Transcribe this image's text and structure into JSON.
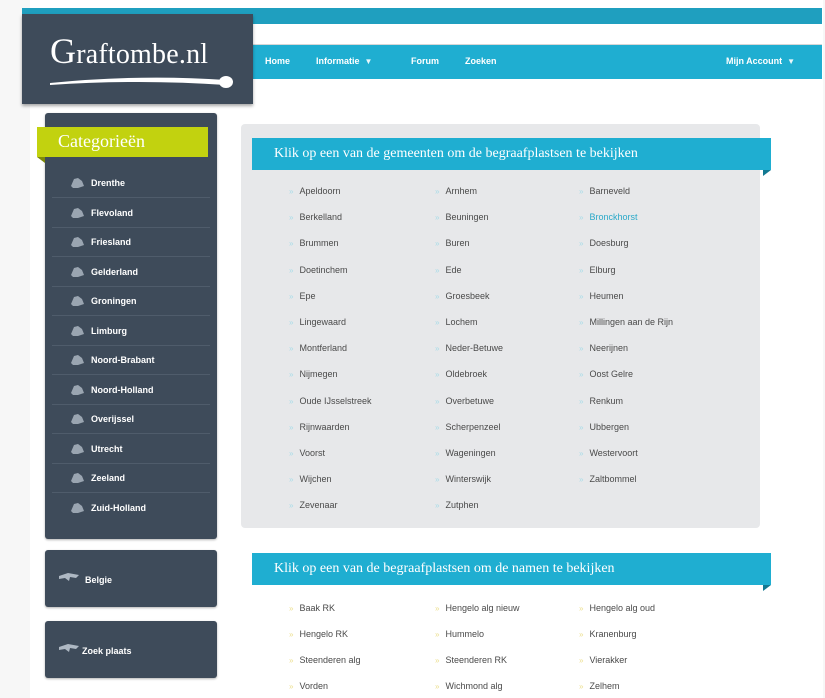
{
  "site": {
    "logo": "Graftombe.nl"
  },
  "nav": [
    {
      "label": "Home",
      "caret": false
    },
    {
      "label": "Informatie",
      "caret": true
    },
    {
      "label": "Forum",
      "caret": false
    },
    {
      "label": "Zoeken",
      "caret": false
    }
  ],
  "account": {
    "label": "Mijn Account"
  },
  "sidebar": {
    "title": "Categorieën",
    "items": [
      {
        "label": "Drenthe",
        "icon": "drenthe-icon"
      },
      {
        "label": "Flevoland",
        "icon": "flevoland-icon"
      },
      {
        "label": "Friesland",
        "icon": "friesland-icon"
      },
      {
        "label": "Gelderland",
        "icon": "gelderland-icon"
      },
      {
        "label": "Groningen",
        "icon": "groningen-icon"
      },
      {
        "label": "Limburg",
        "icon": "limburg-icon"
      },
      {
        "label": "Noord-Brabant",
        "icon": "noord-brabant-icon"
      },
      {
        "label": "Noord-Holland",
        "icon": "noord-holland-icon"
      },
      {
        "label": "Overijssel",
        "icon": "overijssel-icon"
      },
      {
        "label": "Utrecht",
        "icon": "utrecht-icon"
      },
      {
        "label": "Zeeland",
        "icon": "zeeland-icon"
      },
      {
        "label": "Zuid-Holland",
        "icon": "zuid-holland-icon"
      }
    ]
  },
  "belgie": {
    "label": "Belgie"
  },
  "zoek": {
    "label": "Zoek plaats"
  },
  "gemeenten": {
    "title": "Klik op een van de gemeenten om de begraafplastsen te bekijken",
    "items": [
      "Apeldoorn",
      "Arnhem",
      "Barneveld",
      "Berkelland",
      "Beuningen",
      "Bronckhorst",
      "Brummen",
      "Buren",
      "Doesburg",
      "Doetinchem",
      "Ede",
      "Elburg",
      "Epe",
      "Groesbeek",
      "Heumen",
      "Lingewaard",
      "Lochem",
      "Millingen aan de Rijn",
      "Montferland",
      "Neder-Betuwe",
      "Neerijnen",
      "Nijmegen",
      "Oldebroek",
      "Oost Gelre",
      "Oude IJsselstreek",
      "Overbetuwe",
      "Renkum",
      "Rijnwaarden",
      "Scherpenzeel",
      "Ubbergen",
      "Voorst",
      "Wageningen",
      "Westervoort",
      "Wijchen",
      "Winterswijk",
      "Zaltbommel",
      "Zevenaar",
      "Zutphen"
    ],
    "active": "Bronckhorst"
  },
  "begraafplaatsen": {
    "title": "Klik op een van de begraafplastsen om de namen te bekijken",
    "items": [
      "Baak RK",
      "Hengelo alg nieuw",
      "Hengelo alg oud",
      "Hengelo RK",
      "Hummelo",
      "Kranenburg",
      "Steenderen alg",
      "Steenderen RK",
      "Vierakker",
      "Vorden",
      "Wichmond alg",
      "Zelhem"
    ]
  },
  "colors": {
    "accent": "#1faed1",
    "sidebar": "#3e4b5a",
    "lime": "#c2d20f",
    "panel": "#e7e8ea"
  }
}
